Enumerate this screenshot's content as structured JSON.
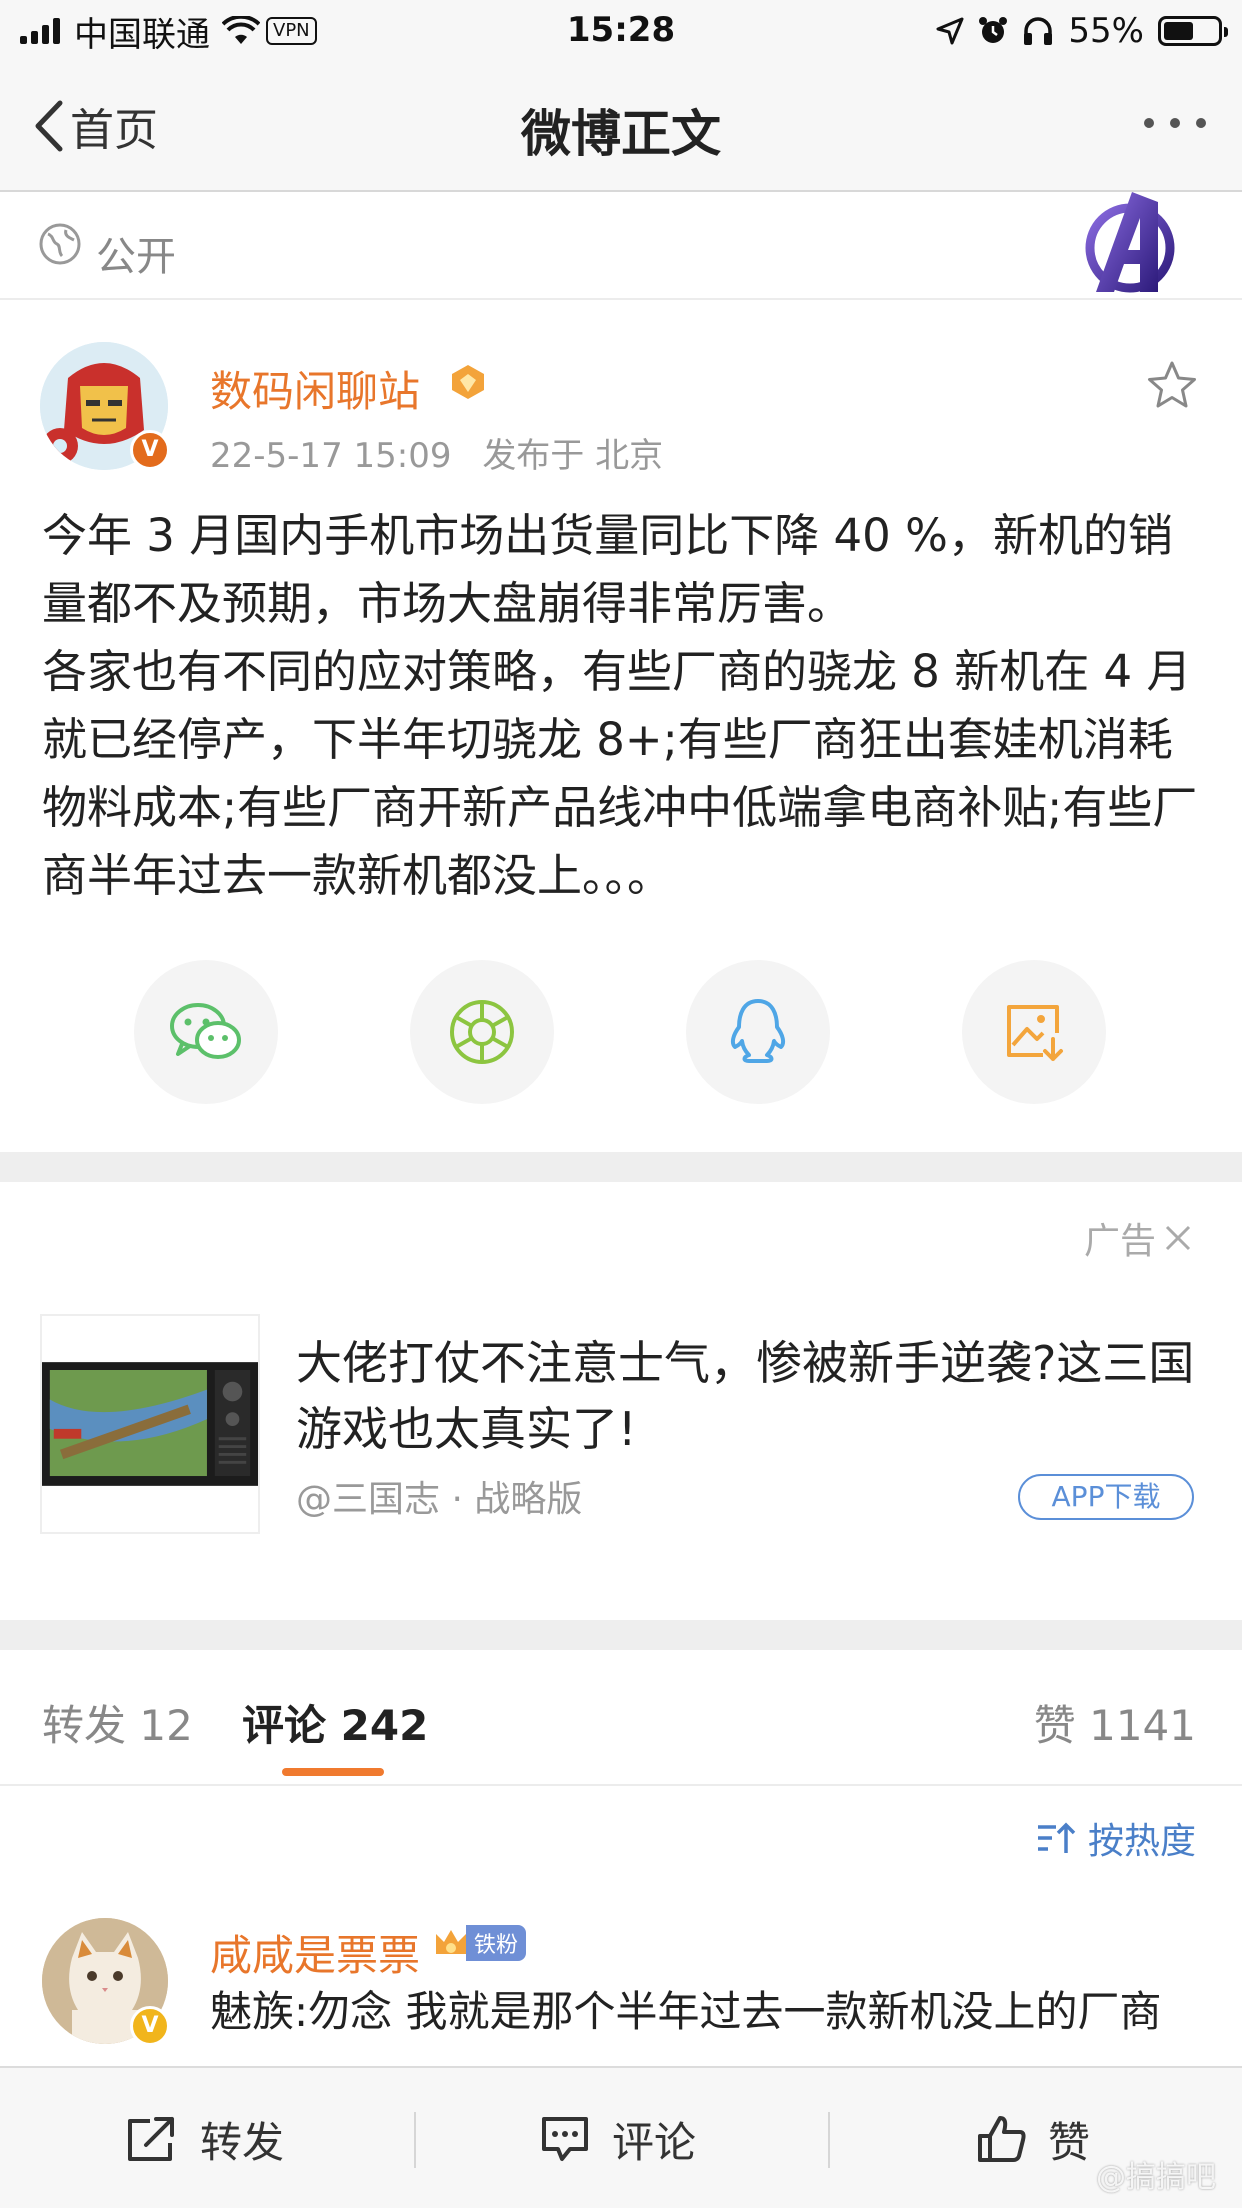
{
  "status_bar": {
    "carrier": "中国联通",
    "vpn": "VPN",
    "time": "15:28",
    "battery": "55%",
    "battery_level": 0.55
  },
  "nav": {
    "back_label": "首页",
    "title": "微博正文"
  },
  "visibility": {
    "label": "公开"
  },
  "post": {
    "username": "数码闲聊站",
    "timestamp": "22-5-17 15:09",
    "location": "发布于 北京",
    "body": "今年 3 月国内手机市场出货量同比下降 40 %，新机的销量都不及预期，市场大盘崩得非常厉害。\n各家也有不同的应对策略，有些厂商的骁龙 8 新机在 4 月就已经停产，下半年切骁龙 8+;有些厂商狂出套娃机消耗物料成本;有些厂商开新产品线冲中低端拿电商补贴;有些厂商半年过去一款新机都没上。。。",
    "verified_mark": "V"
  },
  "share": {
    "items": [
      "wechat-icon",
      "moments-icon",
      "qq-icon",
      "save-image-icon"
    ]
  },
  "ad": {
    "label": "广告",
    "title": "大佬打仗不注意士气，惨被新手逆袭?这三国游戏也太真实了!",
    "source": "@三国志 · 战略版",
    "button": "APP下载"
  },
  "tabs": {
    "repost": "转发 12",
    "comment": "评论 242",
    "like": "赞 1141"
  },
  "sort": {
    "label": "按热度"
  },
  "comment": {
    "username": "咸咸是票票",
    "badge": "铁粉",
    "text": "魅族:勿念 我就是那个半年过去一款新机没上的厂商",
    "verified_mark": "V"
  },
  "bottom_bar": {
    "repost": "转发",
    "comment": "评论",
    "like": "赞"
  },
  "watermark": "@搞搞吧",
  "colors": {
    "accent_orange": "#e8762b",
    "link_blue": "#4a7fc8",
    "wechat_green": "#5cc06a",
    "moments_green": "#8cc540",
    "qq_blue": "#4fa6e6",
    "save_orange": "#f3a53c"
  }
}
